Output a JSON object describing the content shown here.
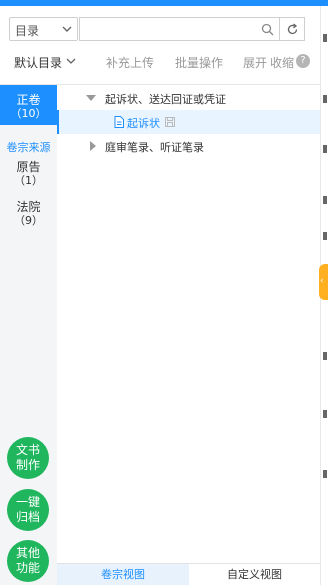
{
  "search": {
    "select_value": "目录",
    "input_value": "",
    "placeholder": ""
  },
  "toolbar": {
    "default_dir": "默认目录",
    "upload": "补充上传",
    "batch": "批量操作",
    "expand": "展开",
    "collapse": "收缩",
    "help": "?"
  },
  "sidebar": {
    "active": {
      "label": "正卷",
      "count": "（10）"
    },
    "section_title": "卷宗来源",
    "items": [
      {
        "label": "原告",
        "count": "（1）"
      },
      {
        "label": "法院",
        "count": "（9）"
      }
    ]
  },
  "tree": {
    "nodes": [
      {
        "label": "起诉状、送达回证或凭证",
        "expanded": true,
        "children": [
          {
            "label": "起诉状"
          }
        ]
      },
      {
        "label": "庭审笔录、听证笔录",
        "expanded": false
      }
    ]
  },
  "fabs": [
    {
      "line1": "文书",
      "line2": "制作"
    },
    {
      "line1": "一键",
      "line2": "归档"
    },
    {
      "line1": "其他",
      "line2": "功能"
    }
  ],
  "tabs": {
    "volume_view": "卷宗视图",
    "custom_view": "自定义视图"
  },
  "colors": {
    "accent": "#1e8fff",
    "fab": "#1fb65e",
    "handle": "#ffb020"
  }
}
